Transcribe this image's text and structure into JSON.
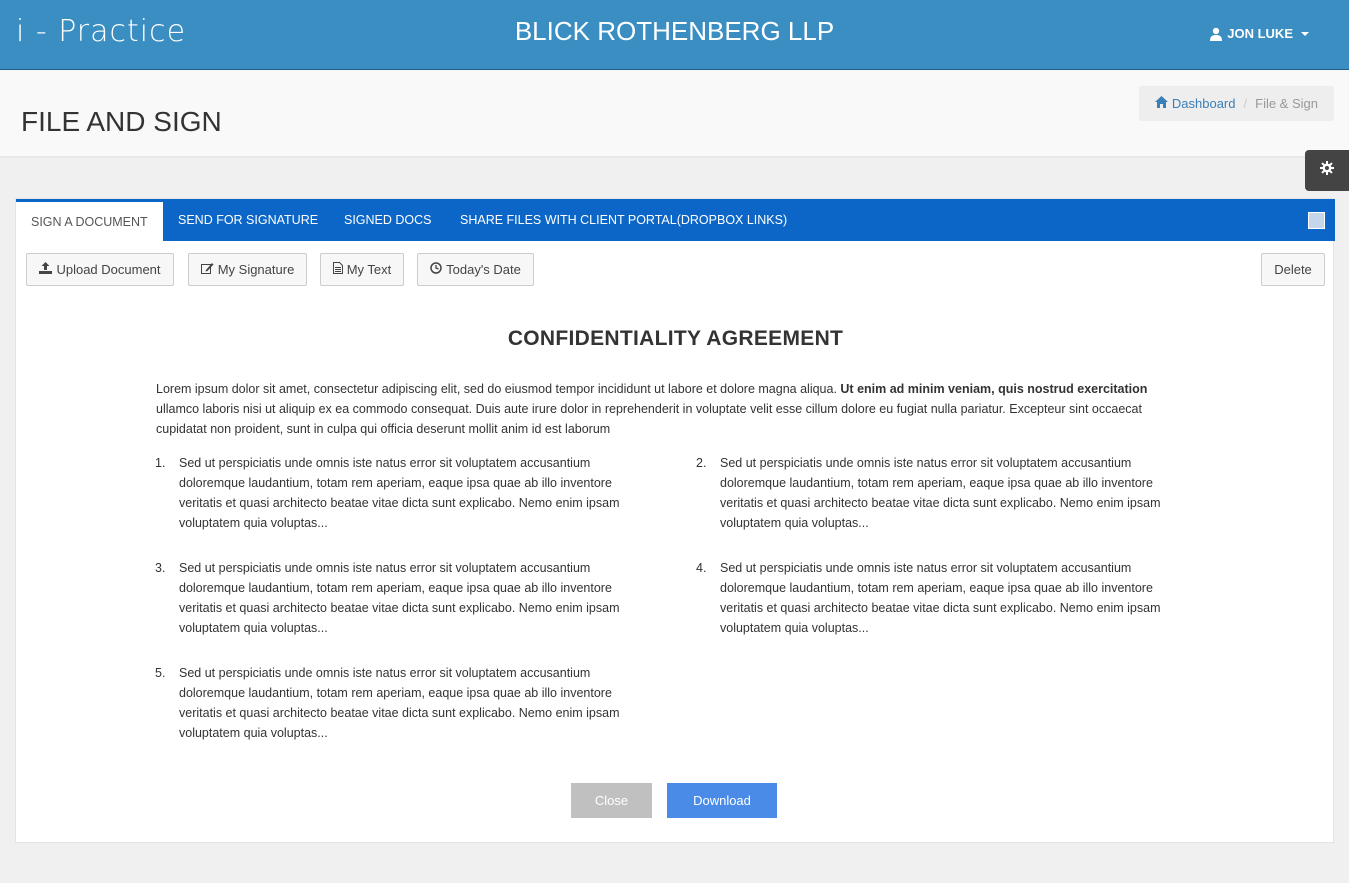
{
  "header": {
    "logo": "i - Practice",
    "company": "BLICK ROTHENBERG LLP",
    "user": "JON LUKE"
  },
  "page": {
    "title": "FILE AND SIGN",
    "breadcrumb": {
      "home": "Dashboard",
      "current": "File & Sign"
    }
  },
  "tabs": [
    {
      "label": "SIGN A DOCUMENT",
      "active": true
    },
    {
      "label": "SEND FOR SIGNATURE",
      "active": false
    },
    {
      "label": "SIGNED DOCS",
      "active": false
    },
    {
      "label": "SHARE FILES WITH CLIENT PORTAL(DROPBOX LINKS)",
      "active": false
    }
  ],
  "toolbar": {
    "upload": "Upload Document",
    "signature": "My Signature",
    "text": "My Text",
    "date": "Today's Date",
    "delete": "Delete"
  },
  "document": {
    "title": "CONFIDENTIALITY AGREEMENT",
    "intro_a": "Lorem ipsum dolor sit amet, consectetur adipiscing elit, sed do eiusmod tempor incididunt ut labore et dolore magna aliqua. ",
    "intro_bold": "Ut enim ad minim veniam, quis nostrud exercitation",
    "intro_b": " ullamco laboris nisi ut aliquip ex ea commodo consequat. Duis aute irure dolor in reprehenderit in voluptate velit esse cillum dolore eu fugiat nulla pariatur. Excepteur sint occaecat cupidatat non proident, sunt in culpa qui officia deserunt mollit anim id est laborum",
    "clauses": [
      {
        "num": "1.",
        "text": "Sed ut perspiciatis unde omnis iste natus error sit voluptatem accusantium doloremque laudantium, totam rem aperiam, eaque ipsa quae ab illo inventore veritatis et quasi architecto beatae vitae dicta sunt explicabo. Nemo enim ipsam voluptatem quia voluptas..."
      },
      {
        "num": "2.",
        "text": "Sed ut perspiciatis unde omnis iste natus error sit voluptatem accusantium doloremque laudantium, totam rem aperiam, eaque ipsa quae ab illo inventore veritatis et quasi architecto beatae vitae dicta sunt explicabo. Nemo enim ipsam voluptatem quia voluptas..."
      },
      {
        "num": "3.",
        "text": "Sed ut perspiciatis unde omnis iste natus error sit voluptatem accusantium doloremque laudantium, totam rem aperiam, eaque ipsa quae ab illo inventore veritatis et quasi architecto beatae vitae dicta sunt explicabo. Nemo enim ipsam voluptatem quia voluptas..."
      },
      {
        "num": "4.",
        "text": "Sed ut perspiciatis unde omnis iste natus error sit voluptatem accusantium doloremque laudantium, totam rem aperiam, eaque ipsa quae ab illo inventore veritatis et quasi architecto beatae vitae dicta sunt explicabo. Nemo enim ipsam voluptatem quia voluptas..."
      },
      {
        "num": "5.",
        "text": "Sed ut perspiciatis unde omnis iste natus error sit voluptatem accusantium doloremque laudantium, totam rem aperiam, eaque ipsa quae ab illo inventore veritatis et quasi architecto beatae vitae dicta sunt explicabo. Nemo enim ipsam voluptatem quia voluptas..."
      }
    ]
  },
  "actions": {
    "close": "Close",
    "download": "Download"
  },
  "colors": {
    "header": "#3a8ec2",
    "tabs": "#0b66c8",
    "download": "#4a8be8",
    "close": "#c0c0c0"
  },
  "icons": [
    "user-icon",
    "home-icon",
    "gear-icon",
    "upload-icon",
    "edit-icon",
    "file-text-icon",
    "clock-icon"
  ]
}
